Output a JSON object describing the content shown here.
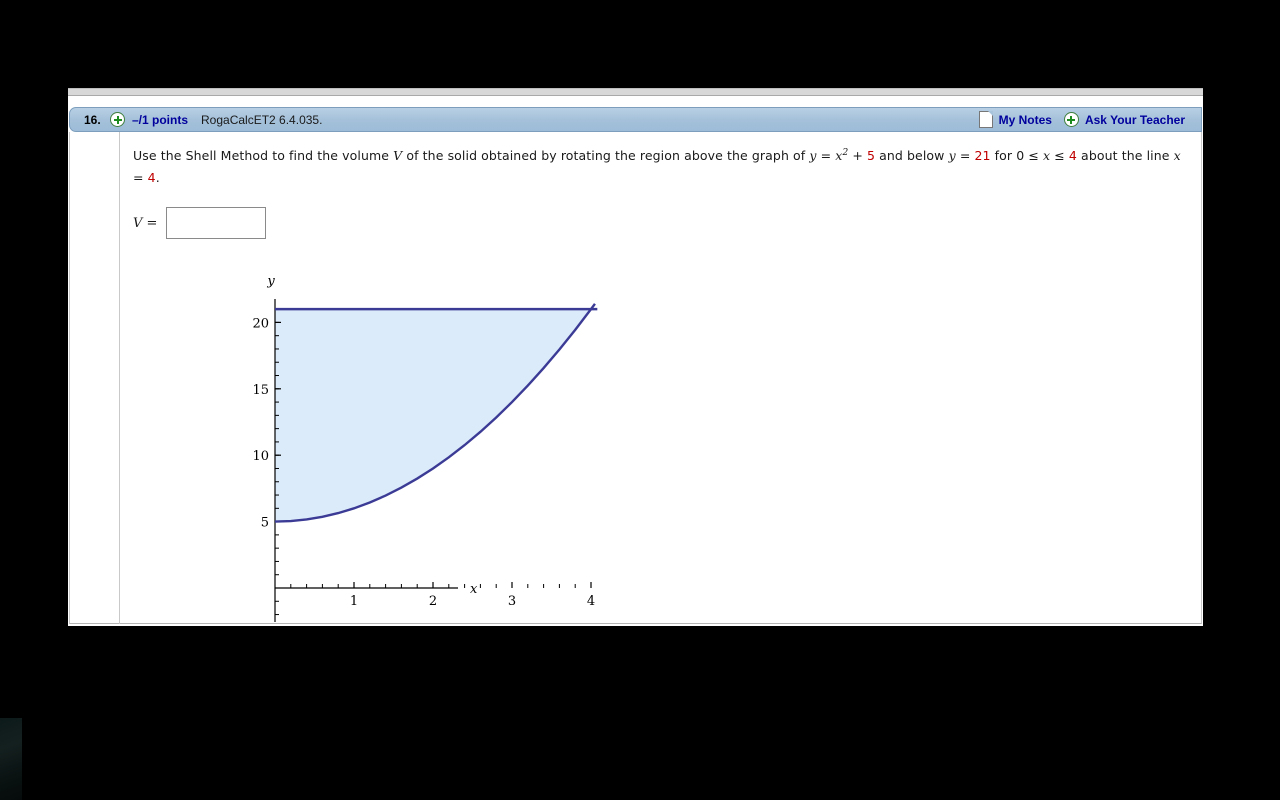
{
  "header": {
    "question_number": "16.",
    "expand_icon": "plus-circle-icon",
    "points": "–/1 points",
    "assignment_code": "RogaCalcET2 6.4.035.",
    "my_notes_label": "My Notes",
    "my_notes_icon": "note-page-icon",
    "ask_teacher_label": "Ask Your Teacher",
    "ask_teacher_icon": "plus-circle-icon",
    "bar_color": "#a5c1da",
    "link_color": "#00009c"
  },
  "question": {
    "text_part1": "Use the Shell Method to find the volume ",
    "var_V": "V",
    "text_part2": " of the solid obtained by rotating the region above the graph of ",
    "eq1_y": "y",
    "eq1_eq": " = ",
    "eq1_x": "x",
    "eq1_exp": "2",
    "eq1_plus": " + ",
    "eq1_const": "5",
    "text_part3": " and below ",
    "eq2_y": "y",
    "eq2_eq": " = ",
    "eq2_val": "21",
    "text_part4": " for ",
    "range_lo": "0",
    "range_le1": " ≤ ",
    "range_x": "x",
    "range_le2": " ≤ ",
    "range_hi": "4",
    "text_part5": " about the line ",
    "line_x": "x",
    "line_eq": " = ",
    "line_val": "4",
    "line_period": ".",
    "highlight_color": "#c00000"
  },
  "answer": {
    "label": "V =",
    "value": "",
    "placeholder": ""
  },
  "chart_data": {
    "type": "area",
    "title": "",
    "xlabel": "x",
    "ylabel": "y",
    "xlim": [
      0,
      4.15
    ],
    "ylim": [
      0,
      22.3
    ],
    "xticks": [
      1,
      2,
      3,
      4
    ],
    "yticks": [
      5,
      10,
      15,
      20
    ],
    "xtick_labels": [
      "1",
      "2",
      "3",
      "4"
    ],
    "ytick_labels": [
      "5",
      "10",
      "15",
      "20"
    ],
    "minor_tick_step_x": 0.2,
    "minor_tick_step_y": 1,
    "grid": false,
    "legend": "none",
    "curve_color": "#3b3b96",
    "fill_color": "#dcebfa",
    "axis_color": "#000000",
    "series": [
      {
        "name": "y = x^2 + 5",
        "kind": "curve",
        "x": [
          0,
          0.2,
          0.4,
          0.6,
          0.8,
          1.0,
          1.2,
          1.4,
          1.6,
          1.8,
          2.0,
          2.2,
          2.4,
          2.6,
          2.8,
          3.0,
          3.2,
          3.4,
          3.6,
          3.8,
          4.0,
          4.05
        ],
        "y": [
          5,
          5.04,
          5.16,
          5.36,
          5.64,
          6,
          6.44,
          6.96,
          7.56,
          8.24,
          9,
          9.84,
          10.76,
          11.76,
          12.84,
          14,
          15.24,
          16.56,
          17.96,
          19.44,
          21,
          21.4
        ]
      },
      {
        "name": "y = 21",
        "kind": "line",
        "x": [
          0,
          4.08
        ],
        "y": [
          21,
          21
        ]
      }
    ],
    "shaded_region": {
      "description": "region between y = x^2 + 5 and y = 21 for 0 <= x <= 4",
      "lower": "y = x^2 + 5",
      "upper": "y = 21",
      "x_range": [
        0,
        4
      ]
    }
  }
}
